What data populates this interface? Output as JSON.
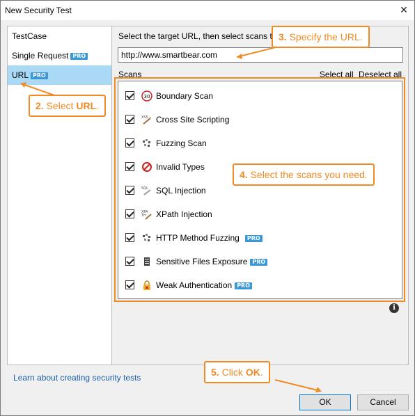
{
  "window": {
    "title": "New Security Test",
    "close_glyph": "✕"
  },
  "left_nav": {
    "items": [
      {
        "label": "TestCase",
        "pro": ""
      },
      {
        "label": "Single Request",
        "pro": "PRO"
      },
      {
        "label": "URL",
        "pro": "PRO"
      }
    ]
  },
  "main": {
    "instruction": "Select the target URL, then select scans to",
    "url_value": "http://www.smartbear.com",
    "scans_label": "Scans",
    "select_all": "Select all",
    "deselect_all": "Deselect all"
  },
  "scans": [
    {
      "label": "Boundary Scan",
      "pro": "",
      "icon": "boundary-icon"
    },
    {
      "label": "Cross Site Scripting",
      "pro": "",
      "icon": "xss-icon"
    },
    {
      "label": "Fuzzing Scan",
      "pro": "",
      "icon": "fuzzing-icon"
    },
    {
      "label": "Invalid Types",
      "pro": "",
      "icon": "invalid-types-icon"
    },
    {
      "label": "SQL Injection",
      "pro": "",
      "icon": "sql-icon"
    },
    {
      "label": "XPath Injection",
      "pro": "",
      "icon": "xpath-icon"
    },
    {
      "label": "HTTP Method Fuzzing",
      "pro": "PRO",
      "icon": "fuzzing-icon"
    },
    {
      "label": "Sensitive Files Exposure",
      "pro": "PRO",
      "icon": "file-icon"
    },
    {
      "label": "Weak Authentication",
      "pro": "PRO",
      "icon": "lock-icon"
    }
  ],
  "footer": {
    "learn_link": "Learn about creating security tests",
    "ok_label": "OK",
    "cancel_label": "Cancel"
  },
  "callouts": {
    "c2_num": "2.",
    "c2_text": "Select ",
    "c2_bold": "URL",
    "c2_end": ".",
    "c3_num": "3.",
    "c3_text": "Specify the URL.",
    "c4_num": "4.",
    "c4_text": "Select the scans you need.",
    "c5_num": "5.",
    "c5_text": "Click ",
    "c5_bold": "OK",
    "c5_end": "."
  },
  "colors": {
    "accent": "#f08a24",
    "pro_badge": "#3a98d8",
    "selection": "#a9d9f5",
    "link": "#1a5ea8"
  }
}
